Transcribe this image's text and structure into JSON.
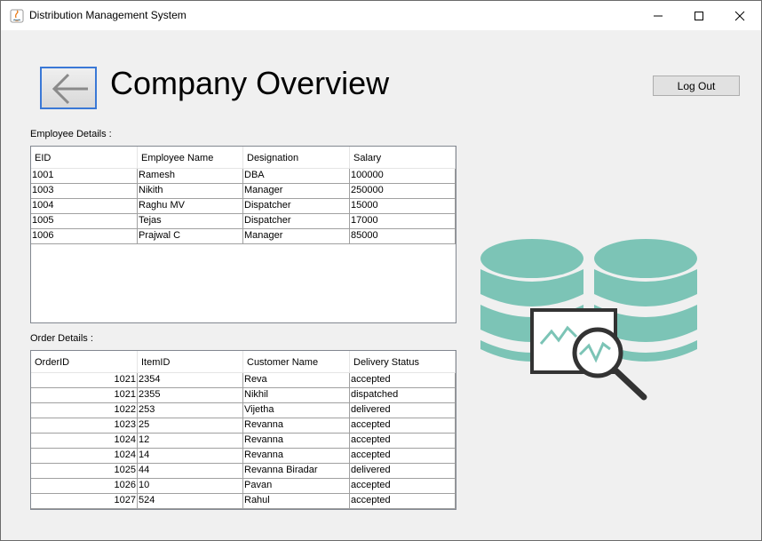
{
  "window": {
    "title": "Distribution Management System",
    "minimize_symbol": "—",
    "maximize_symbol": "☐",
    "close_symbol": "✕"
  },
  "header": {
    "back_icon": "arrow-left-icon",
    "title": "Company Overview",
    "logout_label": "Log Out"
  },
  "employees": {
    "label": "Employee Details :",
    "columns": [
      "EID",
      "Employee Name",
      "Designation",
      "Salary"
    ],
    "rows": [
      [
        "1001",
        "Ramesh",
        "DBA",
        "100000"
      ],
      [
        "1003",
        "Nikith",
        "Manager",
        "250000"
      ],
      [
        "1004",
        "Raghu MV",
        "Dispatcher",
        "15000"
      ],
      [
        "1005",
        "Tejas",
        "Dispatcher",
        "17000"
      ],
      [
        "1006",
        "Prajwal C",
        "Manager",
        "85000"
      ]
    ]
  },
  "orders": {
    "label": "Order Details :",
    "columns": [
      "OrderID",
      "ItemID",
      "Customer Name",
      "Delivery Status"
    ],
    "rows": [
      [
        "1021",
        "2354",
        "Reva",
        "accepted"
      ],
      [
        "1021",
        "2355",
        "Nikhil",
        "dispatched"
      ],
      [
        "1022",
        "253",
        "Vijetha",
        "delivered"
      ],
      [
        "1023",
        "25",
        "Revanna",
        "accepted"
      ],
      [
        "1024",
        "12",
        "Revanna",
        "accepted"
      ],
      [
        "1024",
        "14",
        "Revanna",
        "accepted"
      ],
      [
        "1025",
        "44",
        "Revanna Biradar",
        "delivered"
      ],
      [
        "1026",
        "10",
        "Pavan",
        "accepted"
      ],
      [
        "1027",
        "524",
        "Rahul",
        "accepted"
      ]
    ]
  },
  "illustration": {
    "icon": "database-analytics-icon",
    "color_teal": "#7cc4b6",
    "color_dark": "#333333"
  }
}
